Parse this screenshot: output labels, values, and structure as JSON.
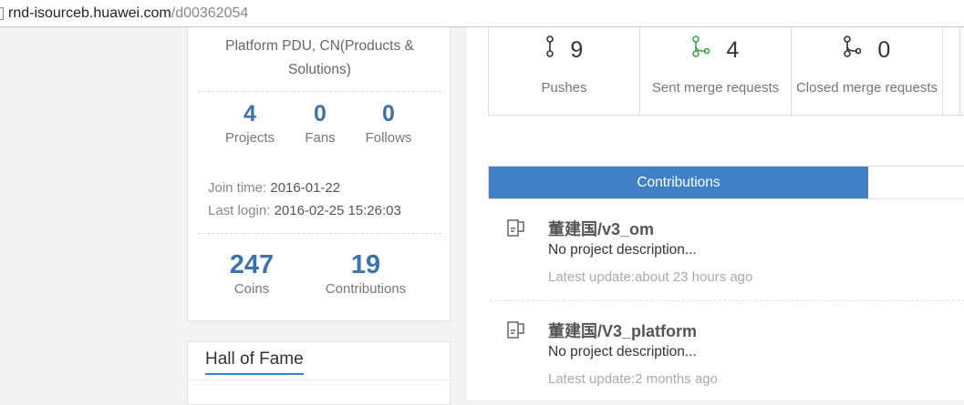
{
  "browser": {
    "url_host": "rnd-isourceb.huawei.com",
    "url_path": "/d00362054"
  },
  "profile": {
    "organization": "Platform PDU, CN(Products & Solutions)",
    "stats": [
      {
        "value": "4",
        "label": "Projects"
      },
      {
        "value": "0",
        "label": "Fans"
      },
      {
        "value": "0",
        "label": "Follows"
      }
    ],
    "join_label": "Join time:",
    "join_value": "2016-01-22",
    "login_label": "Last login:",
    "login_value": "2016-02-25 15:26:03",
    "coins_value": "247",
    "coins_label": "Coins",
    "contrib_value": "19",
    "contrib_label": "Contributions"
  },
  "hall_of_fame": {
    "title": "Hall of Fame"
  },
  "activity": {
    "pushes": {
      "count": "9",
      "label": "Pushes",
      "icon": "commit-icon"
    },
    "sent_mr": {
      "count": "4",
      "label": "Sent merge requests",
      "icon": "merge-request-icon",
      "color": "#3aa544"
    },
    "closed_mr": {
      "count": "0",
      "label": "Closed merge requests",
      "icon": "merge-closed-icon"
    }
  },
  "tabs": {
    "active_label": "Contributions"
  },
  "projects": [
    {
      "name": "董建国/v3_om",
      "description": "No project description...",
      "updated": "Latest update:about 23 hours ago"
    },
    {
      "name": "董建国/V3_platform",
      "description": "No project description...",
      "updated": "Latest update:2 months ago"
    }
  ]
}
